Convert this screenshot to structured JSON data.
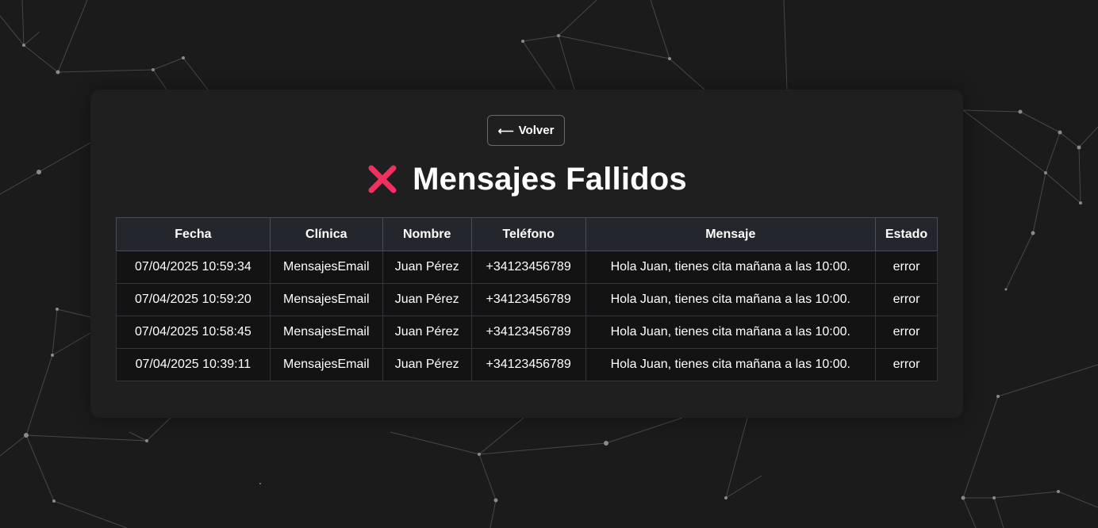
{
  "back_button": {
    "label": "Volver",
    "icon": "arrow-left-icon"
  },
  "header": {
    "title": "Mensajes Fallidos",
    "icon": "x-mark-icon",
    "icon_color": "#f0305f"
  },
  "table": {
    "columns": [
      "Fecha",
      "Clínica",
      "Nombre",
      "Teléfono",
      "Mensaje",
      "Estado"
    ],
    "rows": [
      [
        "07/04/2025 10:59:34",
        "MensajesEmail",
        "Juan Pérez",
        "+34123456789",
        "Hola Juan, tienes cita mañana a las 10:00.",
        "error"
      ],
      [
        "07/04/2025 10:59:20",
        "MensajesEmail",
        "Juan Pérez",
        "+34123456789",
        "Hola Juan, tienes cita mañana a las 10:00.",
        "error"
      ],
      [
        "07/04/2025 10:58:45",
        "MensajesEmail",
        "Juan Pérez",
        "+34123456789",
        "Hola Juan, tienes cita mañana a las 10:00.",
        "error"
      ],
      [
        "07/04/2025 10:39:11",
        "MensajesEmail",
        "Juan Pérez",
        "+34123456789",
        "Hola Juan, tienes cita mañana a las 10:00.",
        "error"
      ]
    ]
  },
  "colors": {
    "background": "#1b1b1b",
    "panel": "#1f1f1f",
    "header_row": "#23262d",
    "accent_x": "#f0305f"
  }
}
